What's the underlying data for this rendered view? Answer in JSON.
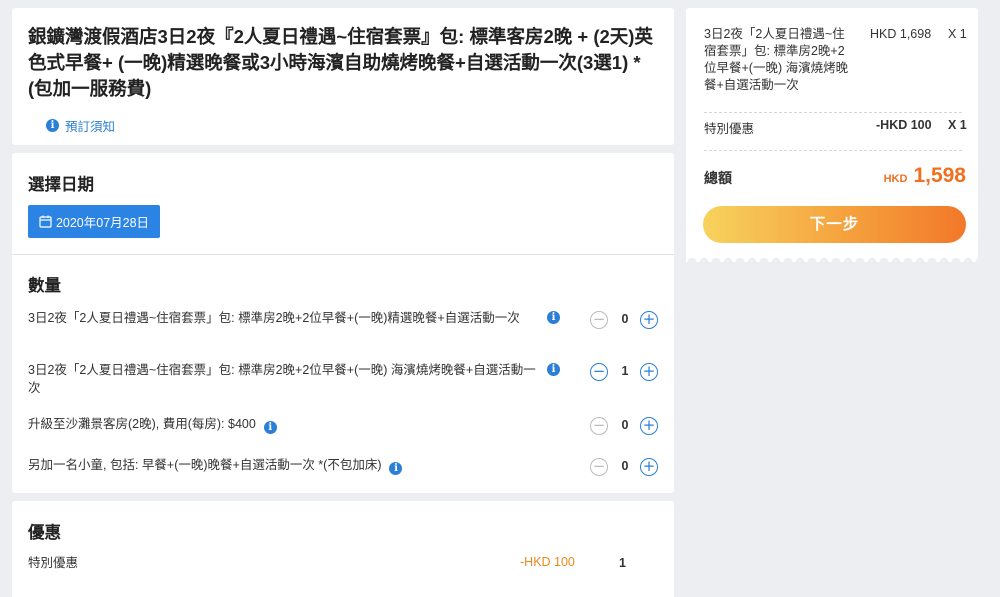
{
  "product": {
    "title": "銀鑛灣渡假酒店3日2夜『2人夏日禮遇~住宿套票』包: 標準客房2晚 + (2天)英色式早餐+ (一晚)精選晚餐或3小時海濱自助燒烤晚餐+自選活動一次(3選1) *(包加一服務費)",
    "notice_link": "預訂須知"
  },
  "date_section": {
    "title": "選擇日期",
    "selected_date": "2020年07月28日"
  },
  "quantity_section": {
    "title": "數量",
    "items": [
      {
        "label": "3日2夜「2人夏日禮遇~住宿套票」包: 標準房2晚+2位早餐+(一晚)精選晚餐+自選活動一次",
        "quantity": "0",
        "minus_disabled": true
      },
      {
        "label": "3日2夜「2人夏日禮遇~住宿套票」包: 標準房2晚+2位早餐+(一晚) 海濱燒烤晚餐+自選活動一次",
        "quantity": "1",
        "minus_disabled": false
      },
      {
        "label": "升級至沙灘景客房(2晚), 費用(每房): $400",
        "quantity": "0",
        "minus_disabled": true
      },
      {
        "label": "另加一名小童, 包括: 早餐+(一晚)晚餐+自選活動一次 *(不包加床)",
        "quantity": "0",
        "minus_disabled": true
      }
    ]
  },
  "discount_section": {
    "title": "優惠",
    "label": "特別優惠",
    "amount": "-HKD 100",
    "quantity": "1"
  },
  "summary": {
    "item_name": "3日2夜「2人夏日禮遇~住宿套票」包: 標準房2晚+2位早餐+(一晚) 海濱燒烤晚餐+自選活動一次",
    "item_price": "HKD 1,698",
    "item_qty": "X 1",
    "discount_name": "特別優惠",
    "discount_price": "-HKD 100",
    "discount_qty": "X 1",
    "total_label": "總額",
    "total_currency": "HKD",
    "total_value": "1,598",
    "next_button": "下一步"
  },
  "colors": {
    "accent_blue": "#2b84e4",
    "price_orange": "#f07020",
    "button_gradient": [
      "#f7d35d",
      "#f27829"
    ],
    "background": "#eceef2"
  },
  "icons": [
    "info-icon",
    "calendar-icon",
    "minus-circle-icon",
    "plus-circle-icon"
  ]
}
